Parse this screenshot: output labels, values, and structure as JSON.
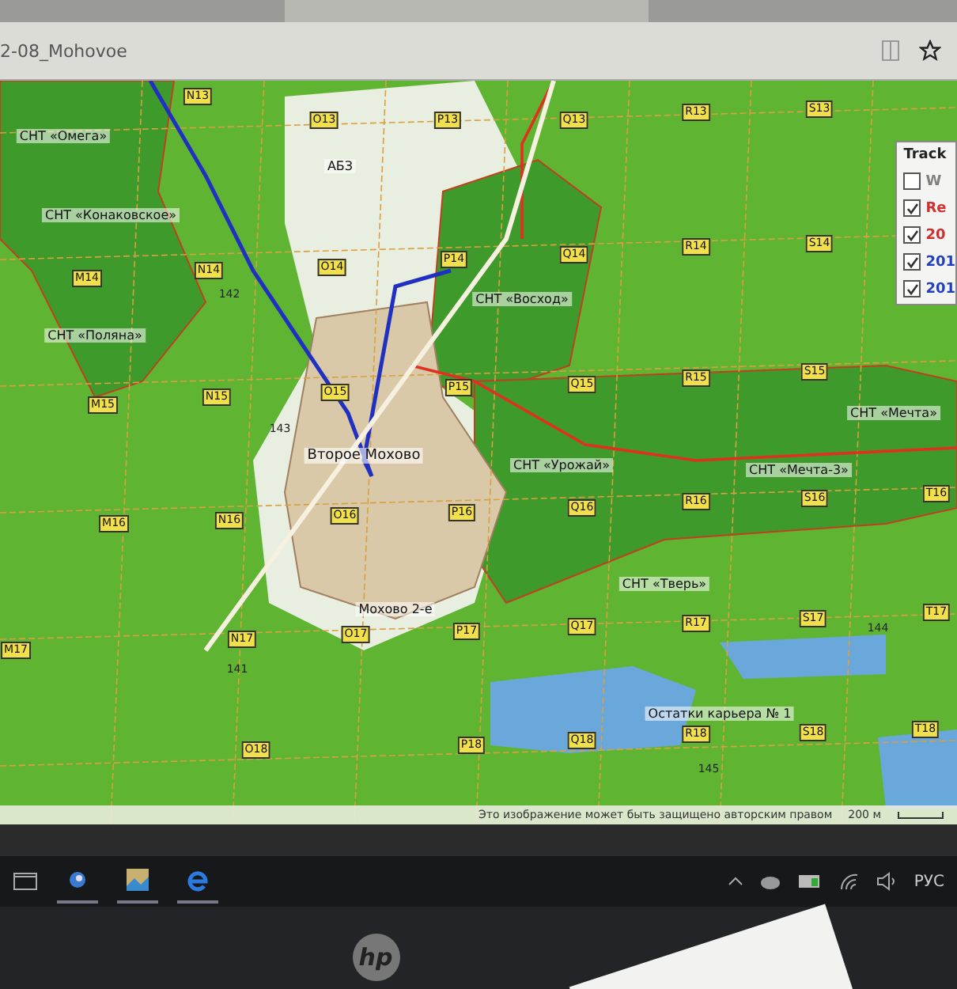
{
  "browser": {
    "address": "2-08_Mohovoe"
  },
  "map": {
    "labels": [
      {
        "text": "СНТ «Омега»",
        "kind": "place"
      },
      {
        "text": "СНТ «Конаковское»",
        "kind": "place"
      },
      {
        "text": "СНТ «Поляна»",
        "kind": "place"
      },
      {
        "text": "АБЗ",
        "kind": "place"
      },
      {
        "text": "СНТ «Восход»",
        "kind": "place"
      },
      {
        "text": "Второе Мохово",
        "kind": "village"
      },
      {
        "text": "СНТ «Урожай»",
        "kind": "place"
      },
      {
        "text": "СНТ «Мечта-3»",
        "kind": "place"
      },
      {
        "text": "СНТ «Мечта»",
        "kind": "place"
      },
      {
        "text": "СНТ «Тверь»",
        "kind": "place"
      },
      {
        "text": "Мохово 2-е",
        "kind": "place"
      },
      {
        "text": "Остатки карьера № 1",
        "kind": "place"
      },
      {
        "text": "142",
        "kind": "elevation"
      },
      {
        "text": "143",
        "kind": "elevation"
      },
      {
        "text": "141",
        "kind": "elevation"
      },
      {
        "text": "144",
        "kind": "elevation"
      },
      {
        "text": "145",
        "kind": "elevation"
      },
      {
        "text": "N13",
        "kind": "grid"
      },
      {
        "text": "O13",
        "kind": "grid"
      },
      {
        "text": "P13",
        "kind": "grid"
      },
      {
        "text": "Q13",
        "kind": "grid"
      },
      {
        "text": "R13",
        "kind": "grid"
      },
      {
        "text": "S13",
        "kind": "grid"
      },
      {
        "text": "M14",
        "kind": "grid"
      },
      {
        "text": "N14",
        "kind": "grid"
      },
      {
        "text": "O14",
        "kind": "grid"
      },
      {
        "text": "P14",
        "kind": "grid"
      },
      {
        "text": "Q14",
        "kind": "grid"
      },
      {
        "text": "R14",
        "kind": "grid"
      },
      {
        "text": "S14",
        "kind": "grid"
      },
      {
        "text": "M15",
        "kind": "grid"
      },
      {
        "text": "N15",
        "kind": "grid"
      },
      {
        "text": "O15",
        "kind": "grid"
      },
      {
        "text": "P15",
        "kind": "grid"
      },
      {
        "text": "Q15",
        "kind": "grid"
      },
      {
        "text": "R15",
        "kind": "grid"
      },
      {
        "text": "S15",
        "kind": "grid"
      },
      {
        "text": "M16",
        "kind": "grid"
      },
      {
        "text": "N16",
        "kind": "grid"
      },
      {
        "text": "O16",
        "kind": "grid"
      },
      {
        "text": "P16",
        "kind": "grid"
      },
      {
        "text": "Q16",
        "kind": "grid"
      },
      {
        "text": "R16",
        "kind": "grid"
      },
      {
        "text": "S16",
        "kind": "grid"
      },
      {
        "text": "T16",
        "kind": "grid"
      },
      {
        "text": "M17",
        "kind": "grid"
      },
      {
        "text": "N17",
        "kind": "grid"
      },
      {
        "text": "O17",
        "kind": "grid"
      },
      {
        "text": "P17",
        "kind": "grid"
      },
      {
        "text": "Q17",
        "kind": "grid"
      },
      {
        "text": "R17",
        "kind": "grid"
      },
      {
        "text": "S17",
        "kind": "grid"
      },
      {
        "text": "T17",
        "kind": "grid"
      },
      {
        "text": "O18",
        "kind": "grid"
      },
      {
        "text": "P18",
        "kind": "grid"
      },
      {
        "text": "Q18",
        "kind": "grid"
      },
      {
        "text": "R18",
        "kind": "grid"
      },
      {
        "text": "S18",
        "kind": "grid"
      },
      {
        "text": "T18",
        "kind": "grid"
      }
    ],
    "tracks_panel": {
      "title": "Track",
      "items": [
        {
          "label": "W",
          "checked": false,
          "color": "#808080"
        },
        {
          "label": "Re",
          "checked": true,
          "color": "#d03030"
        },
        {
          "label": "20",
          "checked": true,
          "color": "#d03030"
        },
        {
          "label": "201",
          "checked": true,
          "color": "#2040c0"
        },
        {
          "label": "201",
          "checked": true,
          "color": "#2040c0"
        }
      ]
    },
    "copyright": "Это изображение может быть защищено авторским правом",
    "scale": "200 м"
  },
  "taskbar": {
    "language": "РУС"
  },
  "bezel": {
    "logo": "hp"
  }
}
